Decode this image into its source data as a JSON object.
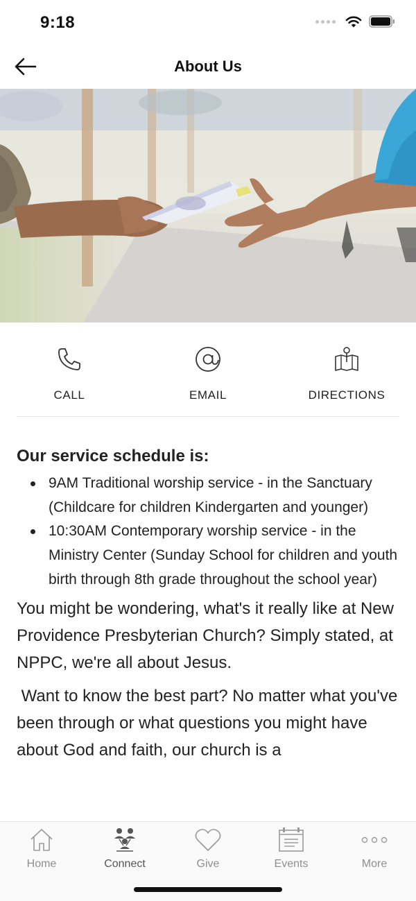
{
  "status_bar": {
    "time": "9:18"
  },
  "nav": {
    "title": "About Us"
  },
  "actions": [
    {
      "label": "CALL",
      "icon": "phone-icon"
    },
    {
      "label": "EMAIL",
      "icon": "at-icon"
    },
    {
      "label": "DIRECTIONS",
      "icon": "map-pin-icon"
    }
  ],
  "content": {
    "heading": "Our service schedule is:",
    "schedule": [
      "9AM Traditional worship service - in the Sanctuary (Childcare for children Kindergarten and younger)",
      "10:30AM Contemporary worship service - in the Ministry Center (Sunday School for children and youth birth through 8th grade throughout the school year)"
    ],
    "paragraphs": [
      "You might be wondering, what's it really like at New Providence Presbyterian Church? Simply stated, at NPPC, we're all about Jesus.",
      " Want to know the best part? No matter what you've been through or what questions you might have about God and faith, our church is a"
    ]
  },
  "tabs": [
    {
      "label": "Home",
      "icon": "home-icon"
    },
    {
      "label": "Connect",
      "icon": "people-icon"
    },
    {
      "label": "Give",
      "icon": "heart-icon"
    },
    {
      "label": "Events",
      "icon": "calendar-icon"
    },
    {
      "label": "More",
      "icon": "more-dots-icon"
    }
  ]
}
